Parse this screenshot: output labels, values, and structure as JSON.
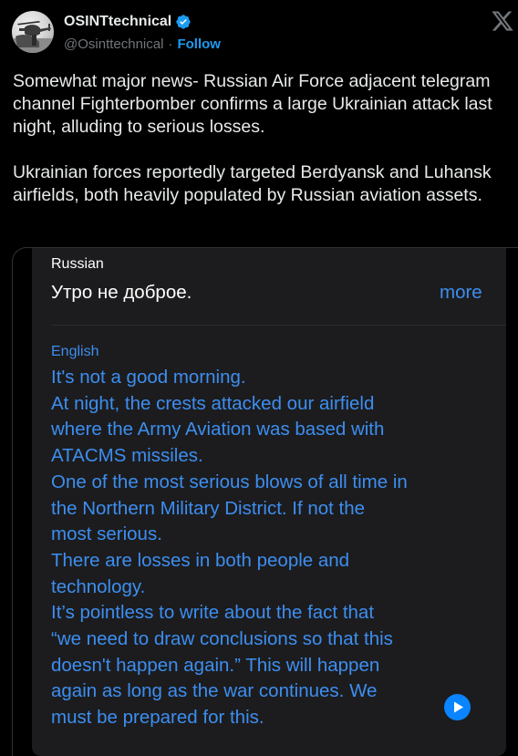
{
  "author": {
    "display_name": "OSINTtechnical",
    "handle": "@Osinttechnical",
    "separator": "·",
    "follow_label": "Follow"
  },
  "tweet": {
    "text": "Somewhat major news- Russian Air Force adjacent telegram channel Fighterbomber confirms a large Ukrainian attack last night, alluding to serious losses.\n\nUkrainian forces reportedly targeted Berdyansk and Luhansk airfields, both heavily populated by Russian aviation assets."
  },
  "translation_card": {
    "source_language": "Russian",
    "source_text": "Утро не доброе.",
    "more_label": "more",
    "target_language": "English",
    "translated_lines": [
      "It's not a good morning.",
      "At night, the crests attacked our airfield",
      "where the Army Aviation was based with",
      "ATACMS missiles.",
      "One of the most serious blows of all time in",
      "the Northern Military District. If not the",
      "most serious.",
      "There are losses in both people and",
      "technology.",
      "It’s pointless to write about the fact that",
      "“we need to draw conclusions so that this",
      "doesn't happen again.” This will happen",
      "again as long as the war continues. We",
      "must be prepared for this."
    ]
  },
  "colors": {
    "background": "#000000",
    "link_blue": "#1d9bf0",
    "translate_blue": "#3d8ef0",
    "card_background": "#1c1c1e",
    "secondary_text": "#71767b"
  },
  "icons": {
    "verified": "verified-badge-icon",
    "platform": "x-logo-icon",
    "play": "play-icon"
  }
}
